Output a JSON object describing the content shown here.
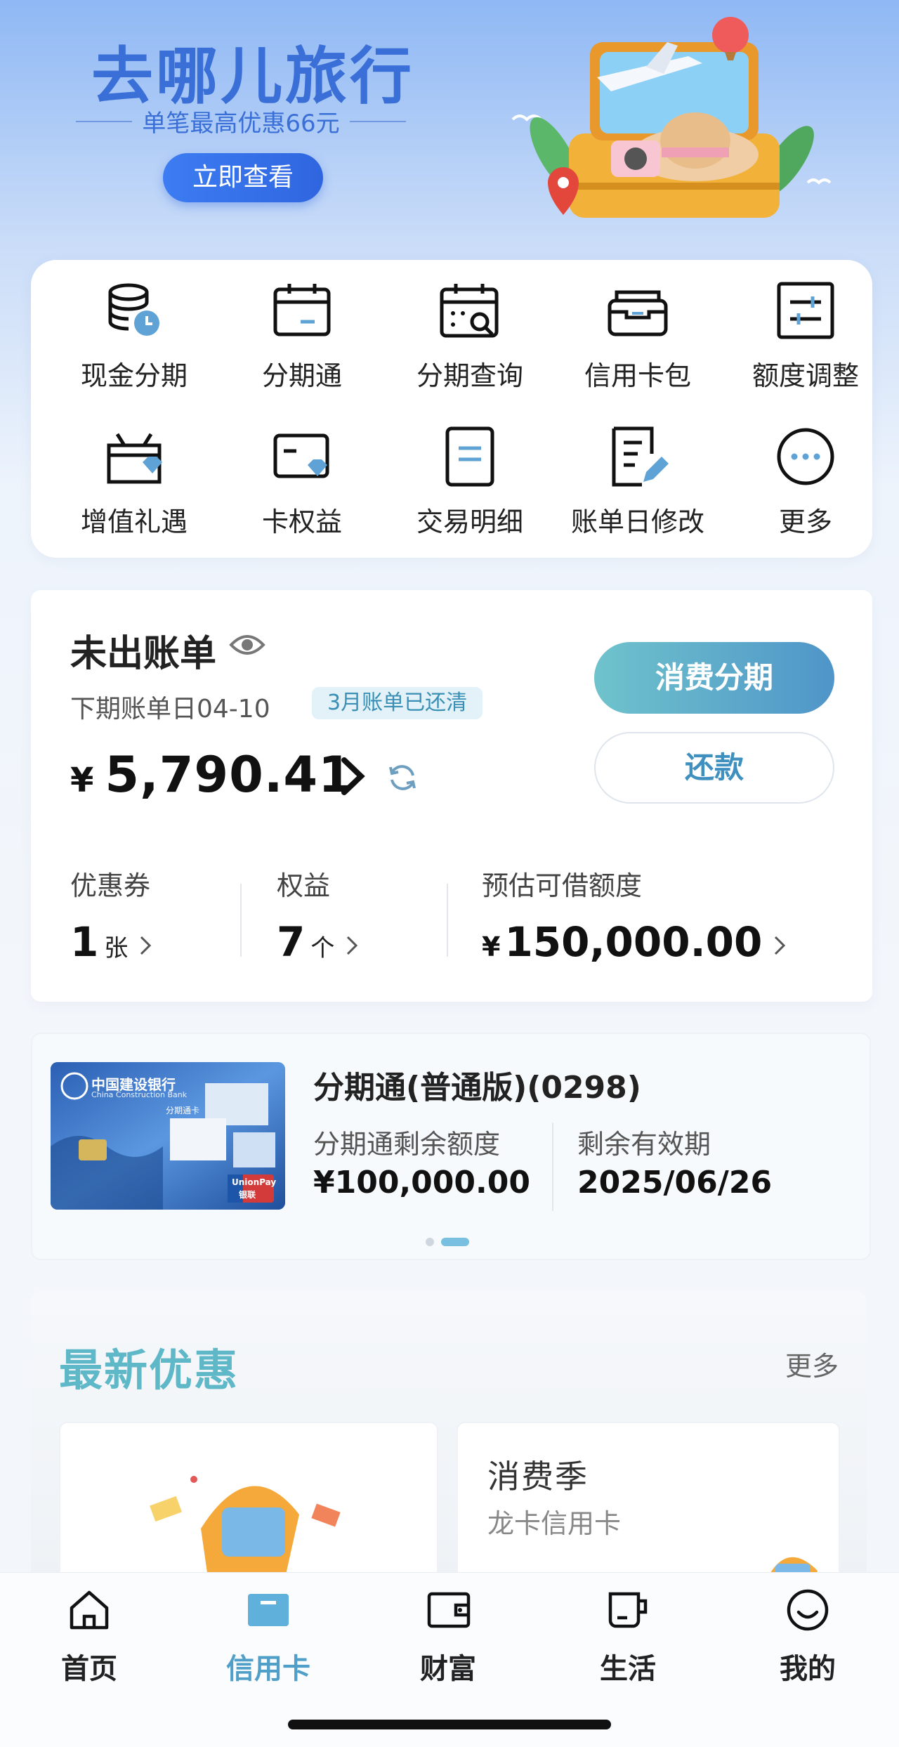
{
  "banner": {
    "title": "去哪儿旅行",
    "subtitle": "单笔最高优惠66元",
    "cta": "立即查看"
  },
  "quick_actions": [
    {
      "label": "现金分期",
      "icon": "coin-stack-clock-icon"
    },
    {
      "label": "分期通",
      "icon": "calendar-icon"
    },
    {
      "label": "分期查询",
      "icon": "calendar-search-icon"
    },
    {
      "label": "信用卡包",
      "icon": "card-wallet-icon"
    },
    {
      "label": "额度调整",
      "icon": "adjust-sliders-icon"
    },
    {
      "label": "增值礼遇",
      "icon": "gift-box-icon"
    },
    {
      "label": "卡权益",
      "icon": "card-diamond-icon"
    },
    {
      "label": "交易明细",
      "icon": "document-list-icon"
    },
    {
      "label": "账单日修改",
      "icon": "document-edit-icon"
    },
    {
      "label": "更多",
      "icon": "more-dots-icon"
    }
  ],
  "bill": {
    "title": "未出账单",
    "next_bill_date": "下期账单日04-10",
    "badge": "3月账单已还清",
    "currency": "¥",
    "amount": "5,790.41",
    "installment_button": "消费分期",
    "repay_button": "还款",
    "stats": {
      "coupon_label": "优惠券",
      "coupon_value": "1",
      "coupon_unit": "张",
      "rights_label": "权益",
      "rights_value": "7",
      "rights_unit": "个",
      "credit_label": "预估可借额度",
      "credit_currency": "¥",
      "credit_value": "150,000.00"
    }
  },
  "installment_card": {
    "title": "分期通(普通版)(0298)",
    "remaining_label": "分期通剩余额度",
    "remaining_value": "¥100,000.00",
    "validity_label": "剩余有效期",
    "validity_value": "2025/06/26",
    "bank_name": "中国建设银行",
    "bank_name_en": "China Construction Bank",
    "card_type": "分期通卡",
    "network": "UnionPay",
    "network_cn": "银联"
  },
  "offers": {
    "title": "最新优惠",
    "more": "更多",
    "card2_title": "消费季",
    "card2_subtitle": "龙卡信用卡"
  },
  "tabbar": [
    {
      "label": "首页",
      "icon": "home-icon",
      "active": false
    },
    {
      "label": "信用卡",
      "icon": "credit-card-icon",
      "active": true
    },
    {
      "label": "财富",
      "icon": "wallet-icon",
      "active": false
    },
    {
      "label": "生活",
      "icon": "cup-icon",
      "active": false
    },
    {
      "label": "我的",
      "icon": "smile-face-icon",
      "active": false
    }
  ],
  "colors": {
    "brand_blue": "#3a6fd8",
    "accent_teal": "#4f9fc9",
    "badge_text": "#3a8fb5"
  }
}
